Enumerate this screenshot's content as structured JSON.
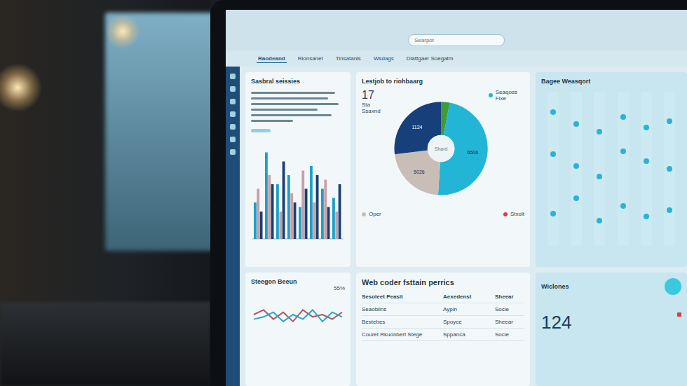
{
  "search": {
    "placeholder": "Searpot"
  },
  "nav": {
    "items": [
      {
        "label": "Raodeand",
        "selected": true
      },
      {
        "label": "Rionsanet",
        "selected": false
      },
      {
        "label": "Tinsatanls",
        "selected": false
      },
      {
        "label": "Wsdags",
        "selected": false
      },
      {
        "label": "Dlattgaer Soegatm",
        "selected": false
      }
    ]
  },
  "summary_card": {
    "title": "Sasbral seissies"
  },
  "bar_chart": {
    "series": [
      {
        "color": "#1f9fc6",
        "values": [
          40,
          95,
          60,
          70,
          35,
          80,
          55,
          45
        ]
      },
      {
        "color": "#c9a0a4",
        "values": [
          55,
          70,
          30,
          50,
          75,
          40,
          65,
          30
        ]
      },
      {
        "color": "#1c3e72",
        "values": [
          30,
          60,
          85,
          40,
          55,
          70,
          35,
          60
        ]
      }
    ]
  },
  "pie_chart": {
    "title": "Lestjob to riohbaarg",
    "value": "17",
    "subtitle": "Sta Ssaxnd",
    "center": "Shard",
    "legend": [
      {
        "label": "Seaqoss Fixe",
        "color": "#22b5d6"
      },
      {
        "label": "Oper",
        "color": "#c9bdb8"
      },
      {
        "label": "Stxolt",
        "color": "#d0404a"
      }
    ],
    "slices": [
      {
        "label": "",
        "value": 3,
        "color": "#3f9a3a"
      },
      {
        "label": "6506",
        "value": 48,
        "color": "#22b5d6"
      },
      {
        "label": "5026",
        "value": 22,
        "color": "#c9bdb8"
      },
      {
        "label": "1124",
        "value": 27,
        "color": "#173f7a"
      }
    ]
  },
  "dot_chart": {
    "title": "Bagee Weasqort",
    "columns": [
      {
        "values": [
          88,
          60,
          20
        ]
      },
      {
        "values": [
          80,
          52,
          30
        ]
      },
      {
        "values": [
          75,
          45,
          15
        ]
      },
      {
        "values": [
          85,
          62,
          25
        ]
      },
      {
        "values": [
          78,
          55,
          18
        ]
      },
      {
        "values": [
          82,
          50,
          22
        ]
      }
    ]
  },
  "line_card": {
    "title": "Steegon Beeun",
    "value": "55%",
    "series": [
      {
        "color": "#b0565f",
        "values": [
          50,
          60,
          40,
          55,
          35,
          60,
          45,
          50,
          40,
          55
        ]
      },
      {
        "color": "#2aa4c8",
        "values": [
          40,
          45,
          55,
          35,
          50,
          40,
          60,
          35,
          55,
          45
        ]
      }
    ]
  },
  "table": {
    "title": "Web coder fsttain perrics",
    "columns": [
      "Sesoleet Peasit",
      "Aexedenst",
      "Sheear"
    ],
    "rows": [
      [
        "Seaoblins",
        "Aypin",
        "Socie"
      ],
      [
        "Bestebes",
        "Spoyce",
        "Sheear"
      ],
      [
        "Couret Rkuonbert Stege",
        "Sppanca",
        "Socie"
      ]
    ]
  },
  "stats_card": {
    "title": "Wiclones",
    "value": "124"
  }
}
